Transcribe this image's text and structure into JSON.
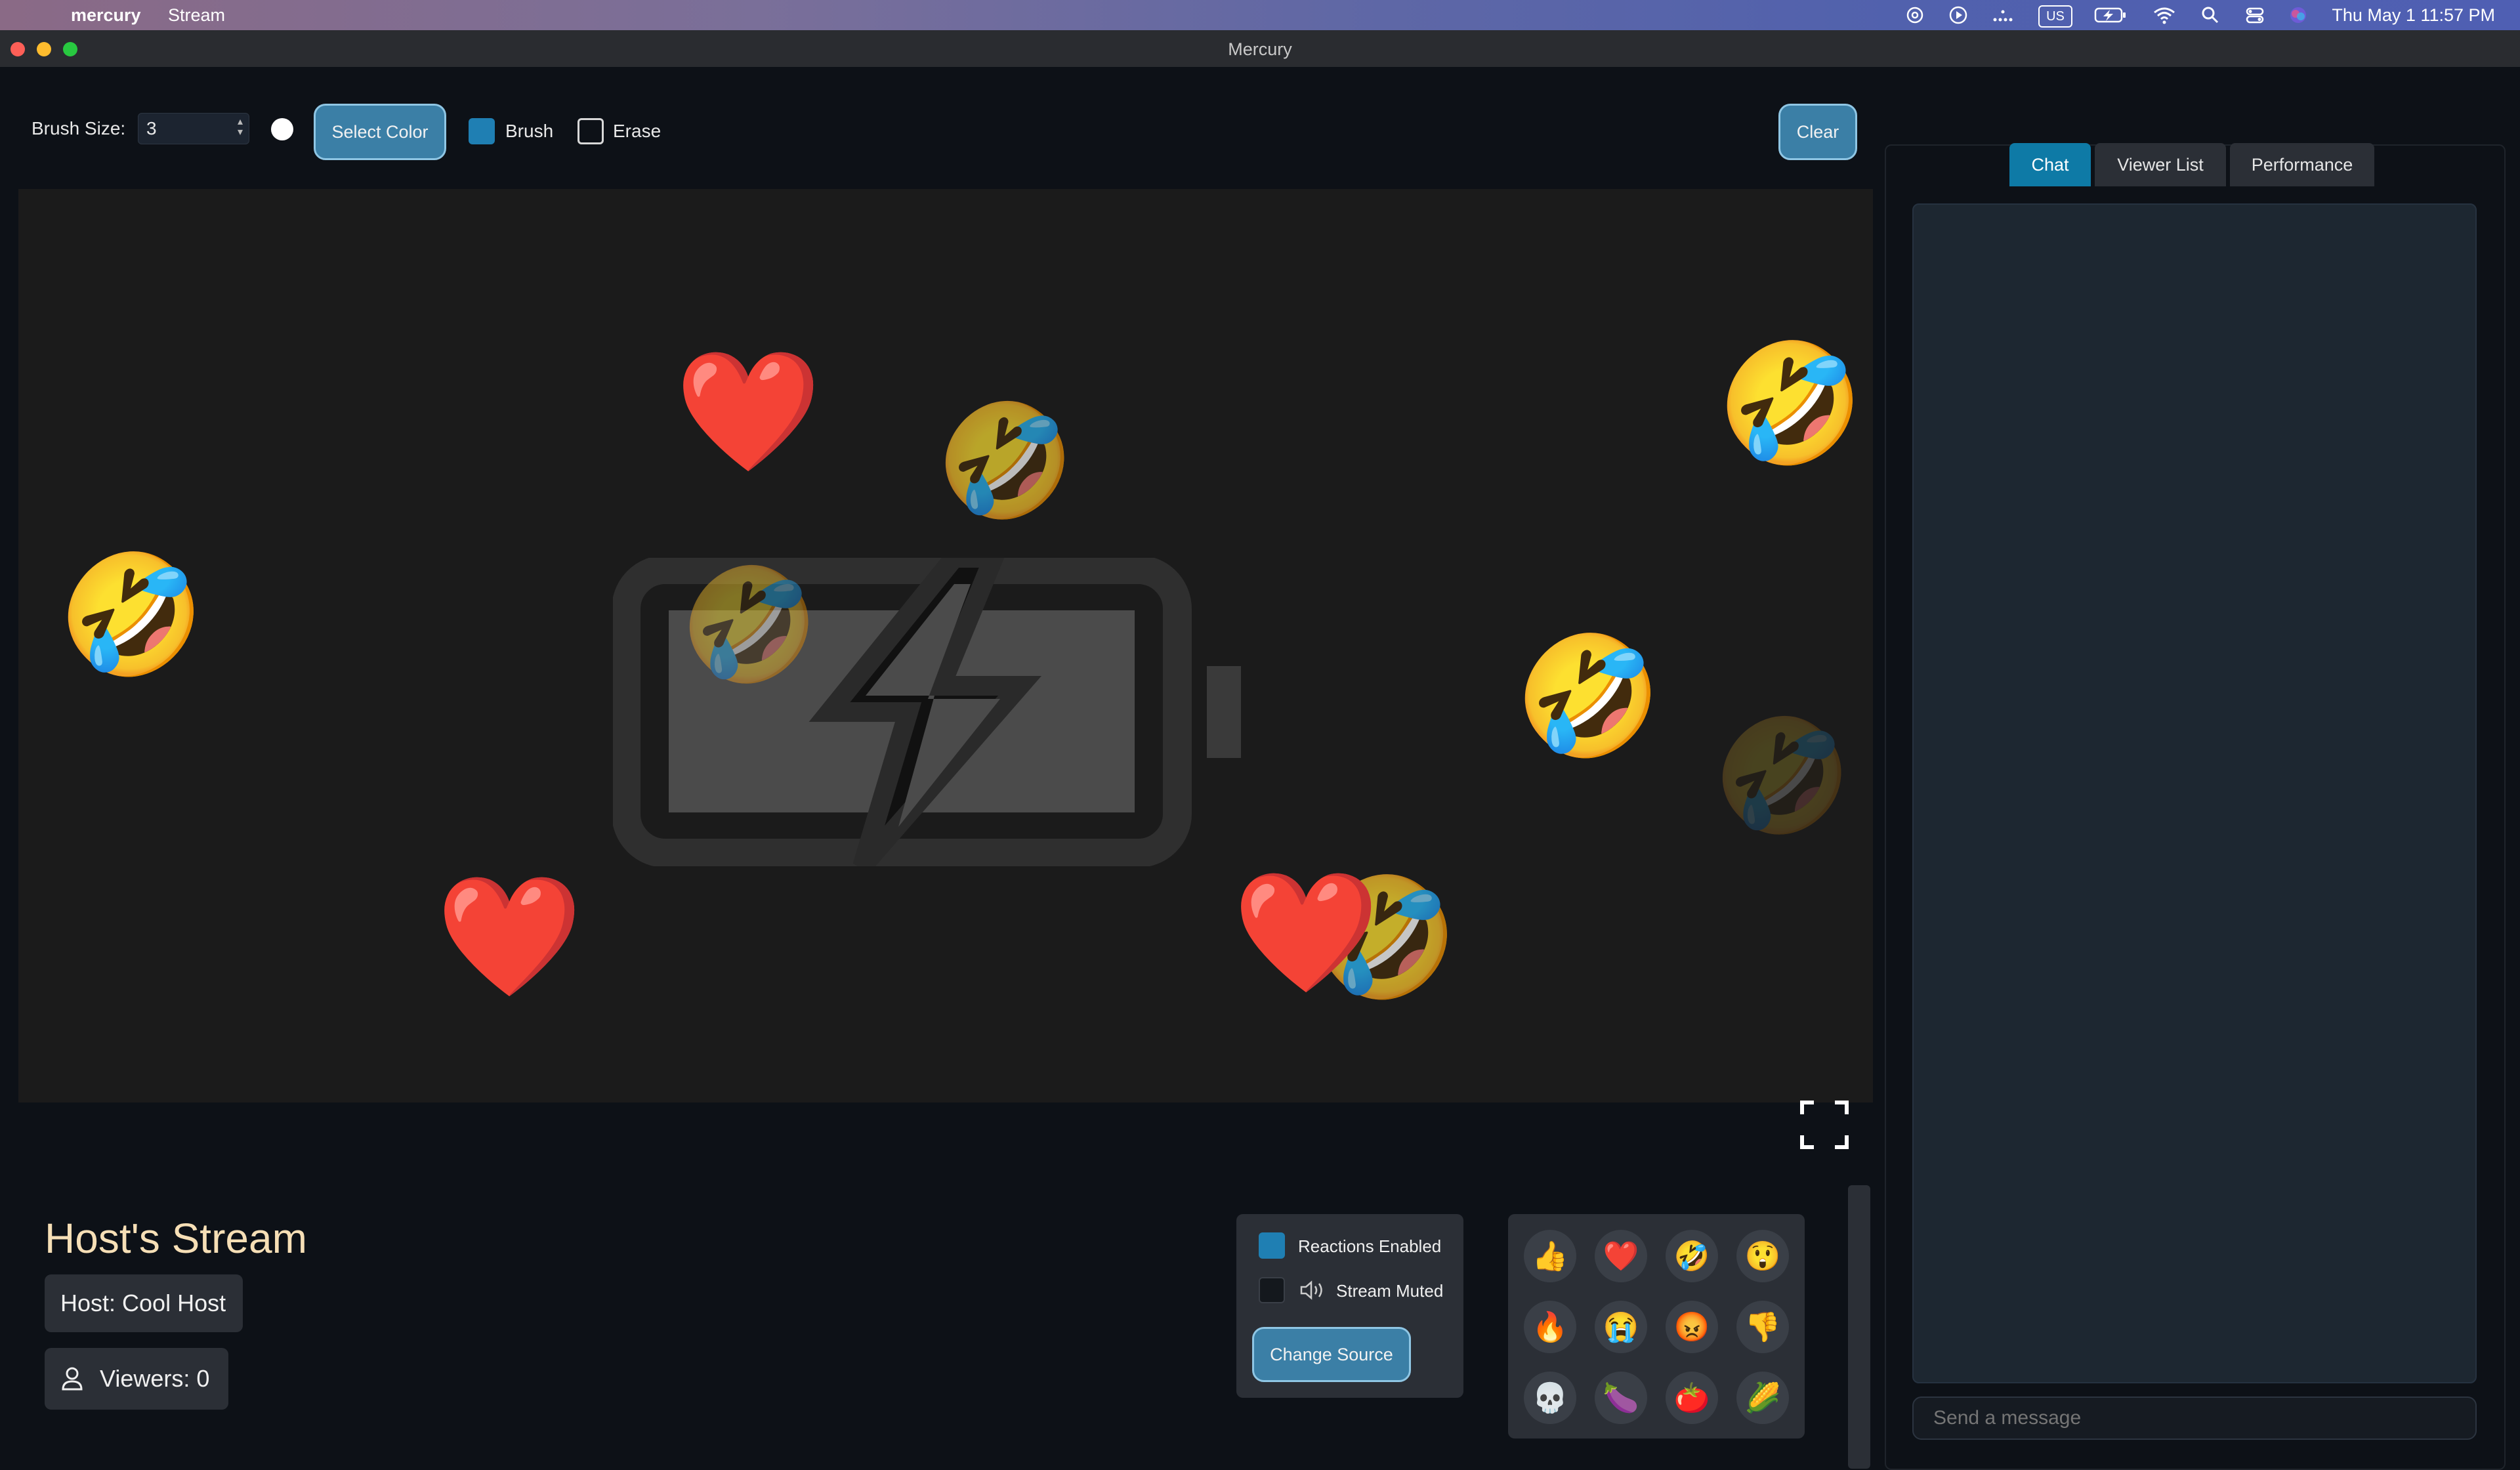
{
  "menubar": {
    "app_name": "mercury",
    "menu_items": [
      "Stream"
    ],
    "status_icons": [
      "chatgpt-icon",
      "play-circle-icon",
      "dots-icon",
      "input-source-icon",
      "battery-charging-icon",
      "wifi-icon",
      "spotlight-icon",
      "control-center-icon",
      "siri-icon"
    ],
    "input_source": "US",
    "clock": "Thu May 1  11:57 PM"
  },
  "window": {
    "title": "Mercury"
  },
  "toolbar": {
    "brush_size_label": "Brush Size:",
    "brush_size_value": "3",
    "select_color_label": "Select Color",
    "brush_label": "Brush",
    "brush_checked": true,
    "erase_label": "Erase",
    "erase_checked": false,
    "clear_label": "Clear",
    "current_color": "#ffffff"
  },
  "canvas": {
    "background_image": "battery-charging-pixel-icon",
    "reactions": [
      "heart",
      "laughing",
      "laughing",
      "heart",
      "heart",
      "laughing",
      "laughing",
      "laughing",
      "laughing",
      "laughing"
    ]
  },
  "stream_info": {
    "title": "Host's Stream",
    "host": "Host: Cool Host",
    "viewers": "Viewers: 0"
  },
  "controls": {
    "reactions_enabled_label": "Reactions Enabled",
    "reactions_enabled": true,
    "stream_muted_label": "Stream Muted",
    "stream_muted": false,
    "change_source_label": "Change Source"
  },
  "reaction_buttons": [
    "👍",
    "❤️",
    "🤣",
    "😲",
    "🔥",
    "😭",
    "😡",
    "👎",
    "💀",
    "🍆",
    "🍅",
    "🌽"
  ],
  "sidebar": {
    "tabs": [
      {
        "label": "Chat",
        "active": true
      },
      {
        "label": "Viewer List",
        "active": false
      },
      {
        "label": "Performance",
        "active": false
      }
    ],
    "message_placeholder": "Send a message"
  },
  "colors": {
    "accent": "#0e7aa6",
    "button": "#3b7fa6",
    "title": "#f6dfb6"
  }
}
